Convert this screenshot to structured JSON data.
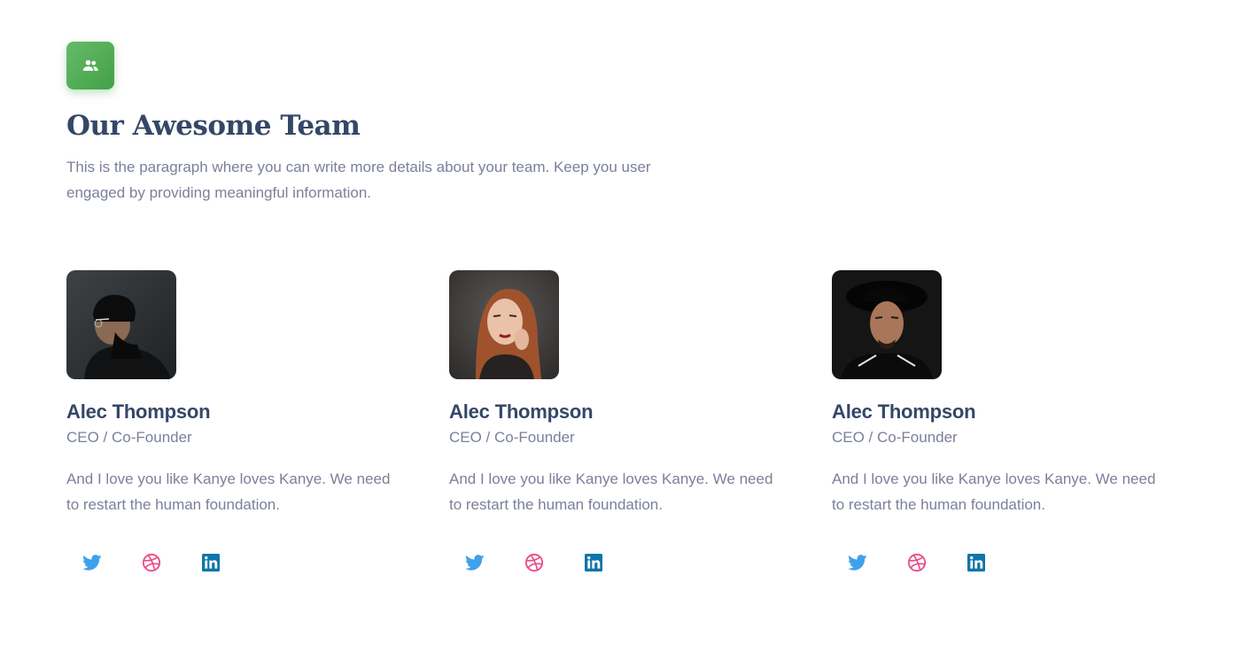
{
  "header": {
    "icon": "group-icon",
    "title": "Our Awesome Team",
    "intro": "This is the paragraph where you can write more details about your team. Keep you user engaged by providing meaningful information."
  },
  "colors": {
    "accent_green": "#4caf50",
    "heading": "#344767",
    "body_text": "#7b809a",
    "twitter": "#3ea1ec",
    "dribbble": "#ea4c89",
    "linkedin": "#0e76a8"
  },
  "team": [
    {
      "photo": "member-photo-hat-glasses",
      "name": "Alec Thompson",
      "role": "CEO / Co-Founder",
      "bio": "And I love you like Kanye loves Kanye. We need to restart the human foundation.",
      "social": [
        "twitter-icon",
        "dribbble-icon",
        "linkedin-icon"
      ]
    },
    {
      "photo": "member-photo-redhead",
      "name": "Alec Thompson",
      "role": "CEO / Co-Founder",
      "bio": "And I love you like Kanye loves Kanye. We need to restart the human foundation.",
      "social": [
        "twitter-icon",
        "dribbble-icon",
        "linkedin-icon"
      ]
    },
    {
      "photo": "member-photo-black-hat",
      "name": "Alec Thompson",
      "role": "CEO / Co-Founder",
      "bio": "And I love you like Kanye loves Kanye. We need to restart the human foundation.",
      "social": [
        "twitter-icon",
        "dribbble-icon",
        "linkedin-icon"
      ]
    }
  ]
}
